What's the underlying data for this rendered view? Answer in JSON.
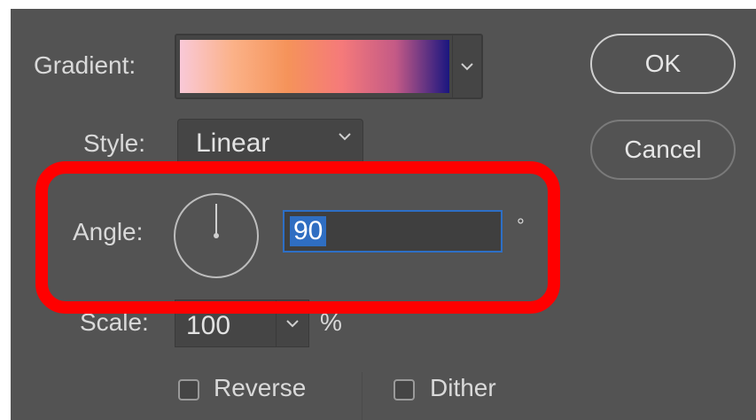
{
  "dialog": {
    "gradient": {
      "label": "Gradient:",
      "stops": [
        "#f9c9d8",
        "#fbb187",
        "#f5935a",
        "#f57a7a",
        "#c45a86",
        "#1a1680"
      ]
    },
    "style": {
      "label": "Style:",
      "value": "Linear"
    },
    "angle": {
      "label": "Angle:",
      "value": "90",
      "unit": "°",
      "degrees": 90
    },
    "scale": {
      "label": "Scale:",
      "value": "100",
      "unit": "%"
    },
    "options": {
      "reverse": {
        "label": "Reverse",
        "checked": false
      },
      "dither": {
        "label": "Dither",
        "checked": false
      }
    },
    "buttons": {
      "ok": "OK",
      "cancel": "Cancel"
    }
  },
  "colors": {
    "panel": "#535353",
    "highlight": "#ff0000",
    "selection": "#2f6ec2"
  }
}
